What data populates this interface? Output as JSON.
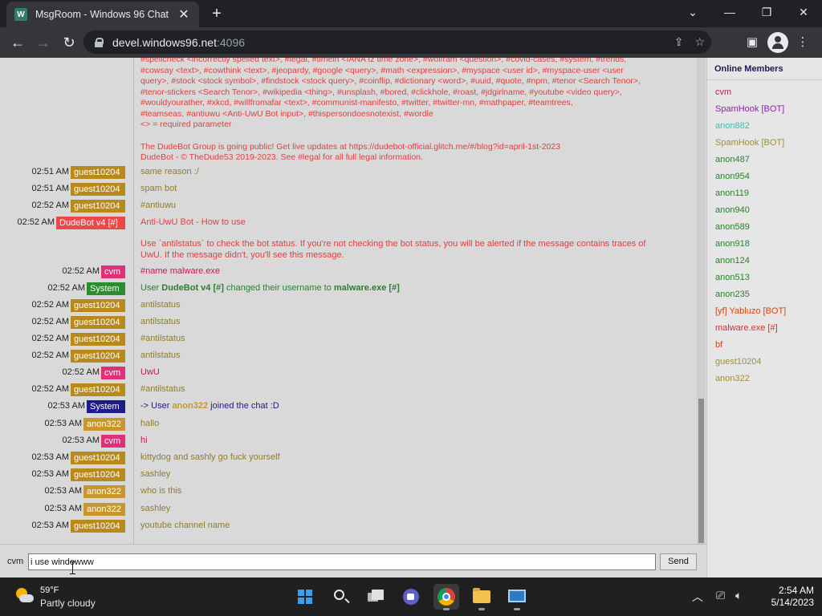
{
  "browser": {
    "tab_title": "MsgRoom - Windows 96 Chat",
    "tab_close": "✕",
    "new_tab": "+",
    "url_host": "devel.windows96.net",
    "url_port": ":4096",
    "window_controls": {
      "dropdown": "⌄",
      "minimize": "—",
      "restore": "❐",
      "close": "✕"
    }
  },
  "help_lines": [
    "#spellcheck <incorrectly spelled text>, #legal, #timein <IANA tz time zone>, #wolfram <question>, #covid-cases, #system, #trends,",
    "#cowsay <text>, #cowthink <text>, #jeopardy, #google <query>, #math <expression>, #myspace <user id>, #myspace-user <user",
    "query>, #stock <stock symbol>, #findstock <stock query>, #coinflip, #dictionary <word>, #uuid, #quote, #npm, #tenor <Search Tenor>,",
    "#tenor-stickers <Search Tenor>, #wikipedia <thing>, #unsplash, #bored, #clickhole, #roast, #jdgirlname, #youtube <video query>,",
    "#wouldyourather, #xkcd, #willfromafar <text>, #communist-manifesto, #twitter, #twitter-mn, #mathpaper, #teamtrees,",
    "#teamseas, #antiuwu <Anti-UwU Bot input>, #thispersondoesnotexist, #wordle",
    "<> = required parameter"
  ],
  "footer_lines": [
    "The DudeBot Group is going public! Get live updates at https://dudebot-official.glitch.me/#/blog?id=april-1st-2023",
    "DudeBot - © TheDude53 2019-2023. See #legal for all full legal information."
  ],
  "messages": [
    {
      "time": "02:51 AM",
      "user": "guest10204",
      "text": "same reason :/"
    },
    {
      "time": "02:51 AM",
      "user": "guest10204",
      "text": "spam bot"
    },
    {
      "time": "02:52 AM",
      "user": "guest10204",
      "text": "#antiuwu"
    },
    {
      "time": "02:52 AM",
      "user": "DudeBot v4 [#]",
      "text": "Anti-UwU Bot - How to use"
    },
    {
      "time": "",
      "user": "",
      "text": "Use `antilstatus` to check the bot status. If you're not checking the bot status, you will be alerted if the message contains traces of"
    },
    {
      "time": "",
      "user": "",
      "text": "UwU. If the message didn't, you'll see this message."
    },
    {
      "time": "02:52 AM",
      "user": "cvm",
      "text": "#name malware.exe"
    },
    {
      "time": "02:52 AM",
      "user": "System",
      "text_pre": "User ",
      "text_b1": "DudeBot v4 [#]",
      "text_mid": " changed their username to ",
      "text_b2": "malware.exe [#]"
    },
    {
      "time": "02:52 AM",
      "user": "guest10204",
      "text": "antilstatus"
    },
    {
      "time": "02:52 AM",
      "user": "guest10204",
      "text": "antilstatus"
    },
    {
      "time": "02:52 AM",
      "user": "guest10204",
      "text": "#antilstatus"
    },
    {
      "time": "02:52 AM",
      "user": "guest10204",
      "text": "antilstatus"
    },
    {
      "time": "02:52 AM",
      "user": "cvm",
      "text": "UwU"
    },
    {
      "time": "02:52 AM",
      "user": "guest10204",
      "text": "#antilstatus"
    },
    {
      "time": "02:53 AM",
      "user": "System",
      "text_pre": "-> User ",
      "text_b1": "anon322",
      "text_mid": " joined the chat :D"
    },
    {
      "time": "02:53 AM",
      "user": "anon322",
      "text": "hallo"
    },
    {
      "time": "02:53 AM",
      "user": "cvm",
      "text": "hi"
    },
    {
      "time": "02:53 AM",
      "user": "guest10204",
      "text": "kittydog and sashly go fuck yourself"
    },
    {
      "time": "02:53 AM",
      "user": "guest10204",
      "text": "sashley"
    },
    {
      "time": "02:53 AM",
      "user": "anon322",
      "text": "who is this"
    },
    {
      "time": "02:53 AM",
      "user": "anon322",
      "text": "sashley"
    },
    {
      "time": "02:53 AM",
      "user": "guest10204",
      "text": "youtube channel name"
    }
  ],
  "members": {
    "title": "Online Members",
    "list": [
      {
        "name": "cvm",
        "color": "#c2185b"
      },
      {
        "name": "SpamHook [BOT]",
        "color": "#8e24aa"
      },
      {
        "name": "anon882",
        "color": "#4db6ac"
      },
      {
        "name": "SpamHook [BOT]",
        "color": "#9e8f3a"
      },
      {
        "name": "anon487",
        "color": "#2e7d32"
      },
      {
        "name": "anon954",
        "color": "#2e7d32"
      },
      {
        "name": "anon119",
        "color": "#2e7d32"
      },
      {
        "name": "anon940",
        "color": "#2e7d32"
      },
      {
        "name": "anon589",
        "color": "#2e7d32"
      },
      {
        "name": "anon918",
        "color": "#2e7d32"
      },
      {
        "name": "anon124",
        "color": "#2e7d32"
      },
      {
        "name": "anon513",
        "color": "#2e7d32"
      },
      {
        "name": "anon235",
        "color": "#2e7d32"
      },
      {
        "name": "[yf] Yabluzo [BOT]",
        "color": "#d84315"
      },
      {
        "name": "malware.exe [#]",
        "color": "#d32f2f"
      },
      {
        "name": "bf",
        "color": "#d84315"
      },
      {
        "name": "guest10204",
        "color": "#9e8f3a"
      },
      {
        "name": "anon322",
        "color": "#9e8f3a"
      }
    ]
  },
  "input": {
    "nick": "cvm",
    "value": "i use windowww",
    "send_label": "Send"
  },
  "taskbar": {
    "temp": "59°F",
    "condition": "Partly cloudy",
    "time": "2:54 AM",
    "date": "5/14/2023"
  },
  "colors": {
    "guest10204": "#b88a1e",
    "DudeBot v4 [#]": "#e84a4a",
    "cvm": "#e0307a",
    "System_green": "#2e8b2e",
    "System_navy": "#1d1a8a",
    "anon322": "#c8962e",
    "msg_guest": "#8f7d2c",
    "msg_red": "#e04040",
    "msg_cvm": "#c2185b",
    "msg_system_green": "#2e7d32",
    "msg_system_navy": "#1d1a8a"
  }
}
